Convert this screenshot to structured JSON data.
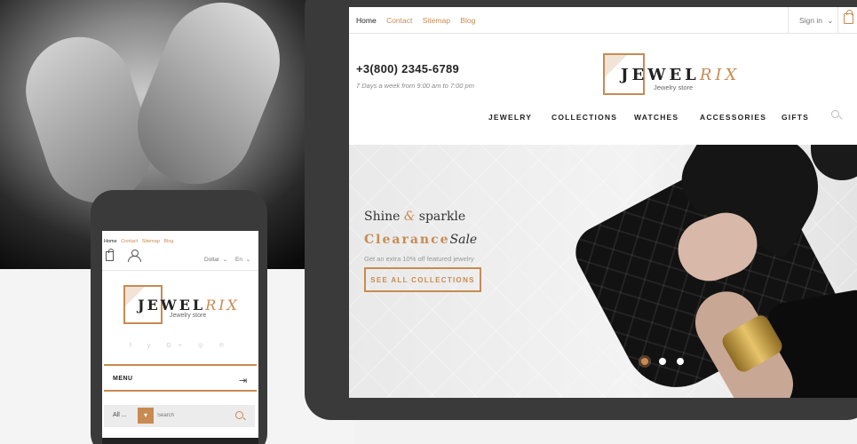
{
  "tablet": {
    "top_links": [
      "Home",
      "Contact",
      "Sitemap",
      "Blog"
    ],
    "signin": "Sign in",
    "signin_chevron": "⌄",
    "phone": "+3(800) 2345-6789",
    "hours": "7 Days a week from 9:00 am to 7:00 pm",
    "logo": {
      "bold": "JEWEL",
      "italic": "RIX",
      "tagline": "Jewelry store"
    },
    "nav": [
      "JEWELRY",
      "COLLECTIONS",
      "WATCHES",
      "ACCESSORIES",
      "GIFTS"
    ],
    "banner": {
      "line1_a": "Shine",
      "line1_amp": "&",
      "line1_b": "sparkle",
      "line2_a": "Clearance",
      "line2_b": "Sale",
      "sub": "Get an extra 10% off featured jewelry",
      "button": "SEE ALL COLLECTIONS",
      "slides": 3,
      "active_slide": 0
    }
  },
  "phone": {
    "top_links": [
      "Home",
      "Contact",
      "Sitemap",
      "Blog"
    ],
    "currency": "Dollar",
    "language": "En",
    "chevron": "⌄",
    "logo": {
      "bold": "JEWEL",
      "italic": "RIX",
      "tagline": "Jewelry store"
    },
    "social": "f  y  G+  ◎  ℗",
    "menu": "MENU",
    "menu_icon": "⇥",
    "search": {
      "category": "All ...",
      "dropdown": "▾",
      "placeholder": "Search"
    }
  },
  "colors": {
    "accent": "#c88a52",
    "dark": "#3a3a3a",
    "text": "#222222"
  }
}
